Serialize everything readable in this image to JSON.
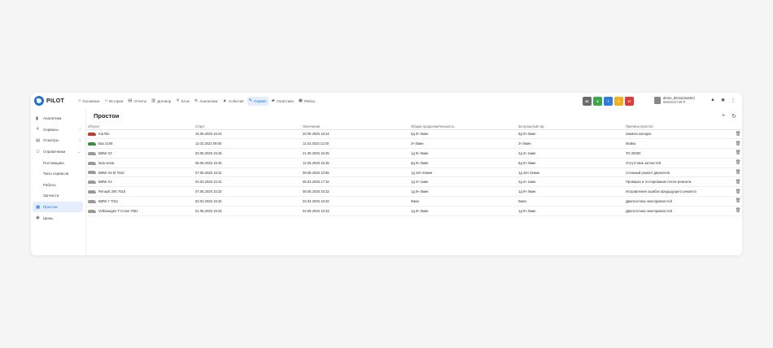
{
  "app": {
    "brand": "PILOT"
  },
  "nav": [
    {
      "icon": "home-icon",
      "glyph": "⌂",
      "label": "Основные"
    },
    {
      "icon": "history-icon",
      "glyph": "⤷",
      "label": "История"
    },
    {
      "icon": "report-icon",
      "glyph": "▤",
      "label": "Отчеты"
    },
    {
      "icon": "contract-icon",
      "glyph": "▥",
      "label": "Договор"
    },
    {
      "icon": "clock-icon",
      "glyph": "✕",
      "label": "Клок"
    },
    {
      "icon": "analytics-icon",
      "glyph": "≋",
      "label": "Аналитика"
    },
    {
      "icon": "bell-icon",
      "glyph": "▲",
      "label": "События"
    },
    {
      "icon": "wrench-icon",
      "glyph": "✎",
      "label": "Сервис"
    },
    {
      "icon": "truck-icon",
      "glyph": "▰",
      "label": "Логистика"
    },
    {
      "icon": "bus-icon",
      "glyph": "▣",
      "label": "Рейсы"
    }
  ],
  "status_chips": [
    {
      "label": "80",
      "color": "#6b6b6b"
    },
    {
      "label": "8",
      "color": "#3aa94a"
    },
    {
      "label": "7",
      "color": "#2f7de1"
    },
    {
      "label": "0",
      "color": "#f2b01e"
    },
    {
      "label": "47",
      "color": "#e03a3a"
    }
  ],
  "user": {
    "name": "demo_demo(master)",
    "id": "9602641739-P"
  },
  "sidebar": [
    {
      "icon": "analytics-icon",
      "glyph": "▮",
      "label": "Аналитика",
      "chevron": ""
    },
    {
      "icon": "services-icon",
      "glyph": "✕",
      "label": "Сервисы",
      "chevron": "›"
    },
    {
      "icon": "operations-icon",
      "glyph": "▤",
      "label": "Осмотры",
      "chevron": "›"
    },
    {
      "icon": "reference-icon",
      "glyph": "⚇",
      "label": "Справочники",
      "chevron": "⌄"
    },
    {
      "icon": "",
      "glyph": "",
      "label": "Поставщики",
      "chevron": "",
      "sub": true
    },
    {
      "icon": "",
      "glyph": "",
      "label": "Типы сервисов",
      "chevron": "",
      "sub": true
    },
    {
      "icon": "",
      "glyph": "",
      "label": "Работы",
      "chevron": "",
      "sub": true
    },
    {
      "icon": "",
      "glyph": "",
      "label": "Запчасти",
      "chevron": "",
      "sub": true
    },
    {
      "icon": "downtime-icon",
      "glyph": "▦",
      "label": "Простои",
      "chevron": "",
      "active": true
    },
    {
      "icon": "tires-icon",
      "glyph": "◉",
      "label": "Шины",
      "chevron": ""
    }
  ],
  "page": {
    "title": "Простои"
  },
  "table": {
    "headers": [
      "Объект",
      "Старт",
      "Окончание",
      "Общая продолжительность",
      "За прошлый год",
      "Причина простоя"
    ],
    "rows": [
      {
        "car_color": "#c0392b",
        "object": "Kia Rio",
        "start": "15.05.2025 15:24",
        "end": "20.05.2025 15:24",
        "total": "5д 0ч 0мин",
        "last_year": "5д 0ч 0мин",
        "reason": "Замена колодок"
      },
      {
        "car_color": "#3a8f3a",
        "object": "Ваз 2106",
        "start": "11.02.2022 09:00",
        "end": "11.02.2022 11:00",
        "total": "2ч 0мин",
        "last_year": "2ч 0мин",
        "reason": "Мойка"
      },
      {
        "car_color": "#9a9a9a",
        "object": "BMW X3",
        "start": "20.05.2025 15:25",
        "end": "21.05.2025 15:25",
        "total": "1д 0ч 0мин",
        "last_year": "2д 2ч 1мин",
        "reason": "ТО 25000"
      },
      {
        "car_color": "#9a9a9a",
        "object": "lada vesta",
        "start": "06.05.2025 15:25",
        "end": "12.05.2025 15:25",
        "total": "6д 0ч 0мин",
        "last_year": "6д 0ч 0мин",
        "reason": "Отсутствие запчастей"
      },
      {
        "car_color": "#9a9a9a",
        "object": "BMW X5 M 7022",
        "start": "07.05.2025 15:31",
        "end": "08.05.2025 10:55",
        "total": "1д 19ч 24мин",
        "last_year": "1д 19ч 24мин",
        "reason": "Сложный ремонт двигателя"
      },
      {
        "car_color": "#9a9a9a",
        "object": "BMW X3",
        "start": "04.03.2025 15:31",
        "end": "05.03.2025 17:32",
        "total": "1д 2ч 1мин",
        "last_year": "2д 2ч 1мин",
        "reason": "Проверка и тестирование после ремонта"
      },
      {
        "car_color": "#9a9a9a",
        "object": "Renault 206 7015",
        "start": "07.05.2025 15:32",
        "end": "08.05.2025 15:32",
        "total": "1д 0ч 0мин",
        "last_year": "1д 0ч 0мин",
        "reason": "Исправление ошибок предыдущего ремонта"
      },
      {
        "car_color": "#9a9a9a",
        "object": "BMW 7 7021",
        "start": "02.04.2025 15:32",
        "end": "02.04.2025 15:32",
        "total": "0мин",
        "last_year": "0мин",
        "reason": "Диагностика неисправностей"
      },
      {
        "car_color": "#9a9a9a",
        "object": "Volkswagen T-Cross 7051",
        "start": "01.05.2025 15:33",
        "end": "02.05.2025 15:33",
        "total": "1д 0ч 0мин",
        "last_year": "1д 0ч 0мин",
        "reason": "Диагностика неисправностей"
      }
    ]
  }
}
